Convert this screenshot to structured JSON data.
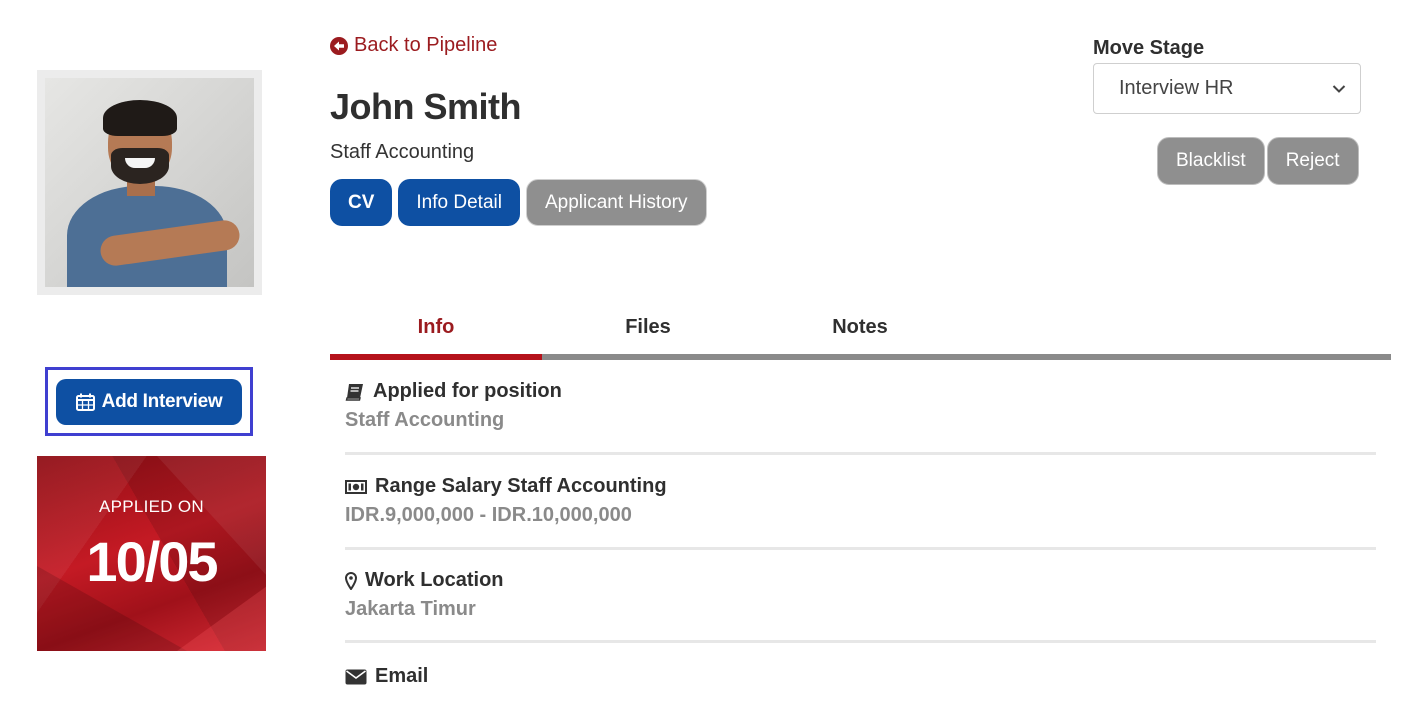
{
  "sidebar": {
    "add_interview_label": "Add Interview",
    "applied_label": "APPLIED ON",
    "applied_date": "10/05"
  },
  "header": {
    "back_label": "Back to Pipeline",
    "candidate_name": "John Smith",
    "candidate_position": "Staff Accounting",
    "buttons": {
      "cv": "CV",
      "info_detail": "Info Detail",
      "applicant_history": "Applicant History"
    }
  },
  "move_stage": {
    "label": "Move Stage",
    "selected": "Interview HR",
    "blacklist": "Blacklist",
    "reject": "Reject"
  },
  "tabs": [
    {
      "label": "Info",
      "active": true
    },
    {
      "label": "Files",
      "active": false
    },
    {
      "label": "Notes",
      "active": false
    }
  ],
  "info": [
    {
      "title": "Applied for position",
      "value": "Staff Accounting",
      "icon": "book-icon"
    },
    {
      "title": "Range Salary Staff Accounting",
      "value": "IDR.9,000,000 - IDR.10,000,000",
      "icon": "money-icon"
    },
    {
      "title": "Work Location",
      "value": "Jakarta Timur",
      "icon": "map-marker-icon"
    },
    {
      "title": "Email",
      "value": "",
      "icon": "envelope-icon"
    }
  ],
  "colors": {
    "primary_blue": "#0e50a3",
    "accent_red": "#9b1b1f",
    "tab_active": "#b5121b",
    "button_gray": "#8f8f8f"
  }
}
